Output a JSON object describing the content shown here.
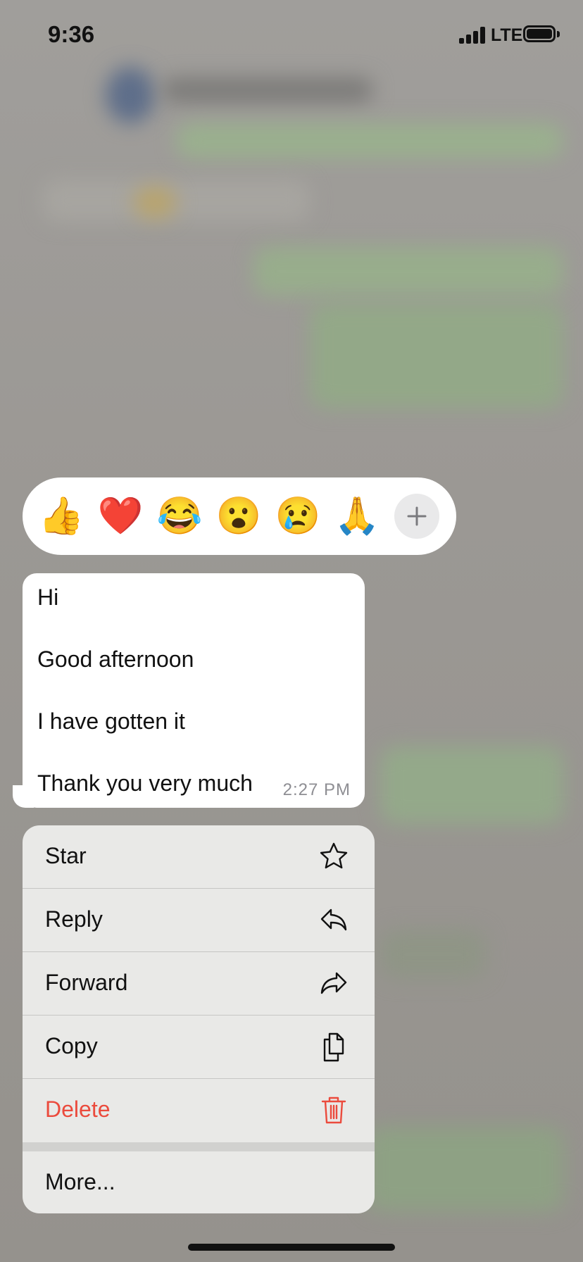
{
  "status_bar": {
    "time": "9:36",
    "network": "LTE"
  },
  "reactions": {
    "emojis": [
      "👍",
      "❤️",
      "😂",
      "😮",
      "😢",
      "🙏"
    ],
    "more_icon": "plus-icon"
  },
  "message": {
    "lines": [
      "Hi",
      "Good afternoon",
      "I have gotten it",
      "Thank you very much"
    ],
    "time": "2:27 PM"
  },
  "menu": {
    "items": [
      {
        "label": "Star",
        "icon": "star-icon"
      },
      {
        "label": "Reply",
        "icon": "reply-icon"
      },
      {
        "label": "Forward",
        "icon": "forward-icon"
      },
      {
        "label": "Copy",
        "icon": "copy-icon"
      },
      {
        "label": "Delete",
        "icon": "trash-icon"
      }
    ],
    "more": "More..."
  },
  "colors": {
    "destructive": "#eb4b3d",
    "menu_bg": "#e9e9e7",
    "bubble_bg": "#ffffff"
  }
}
